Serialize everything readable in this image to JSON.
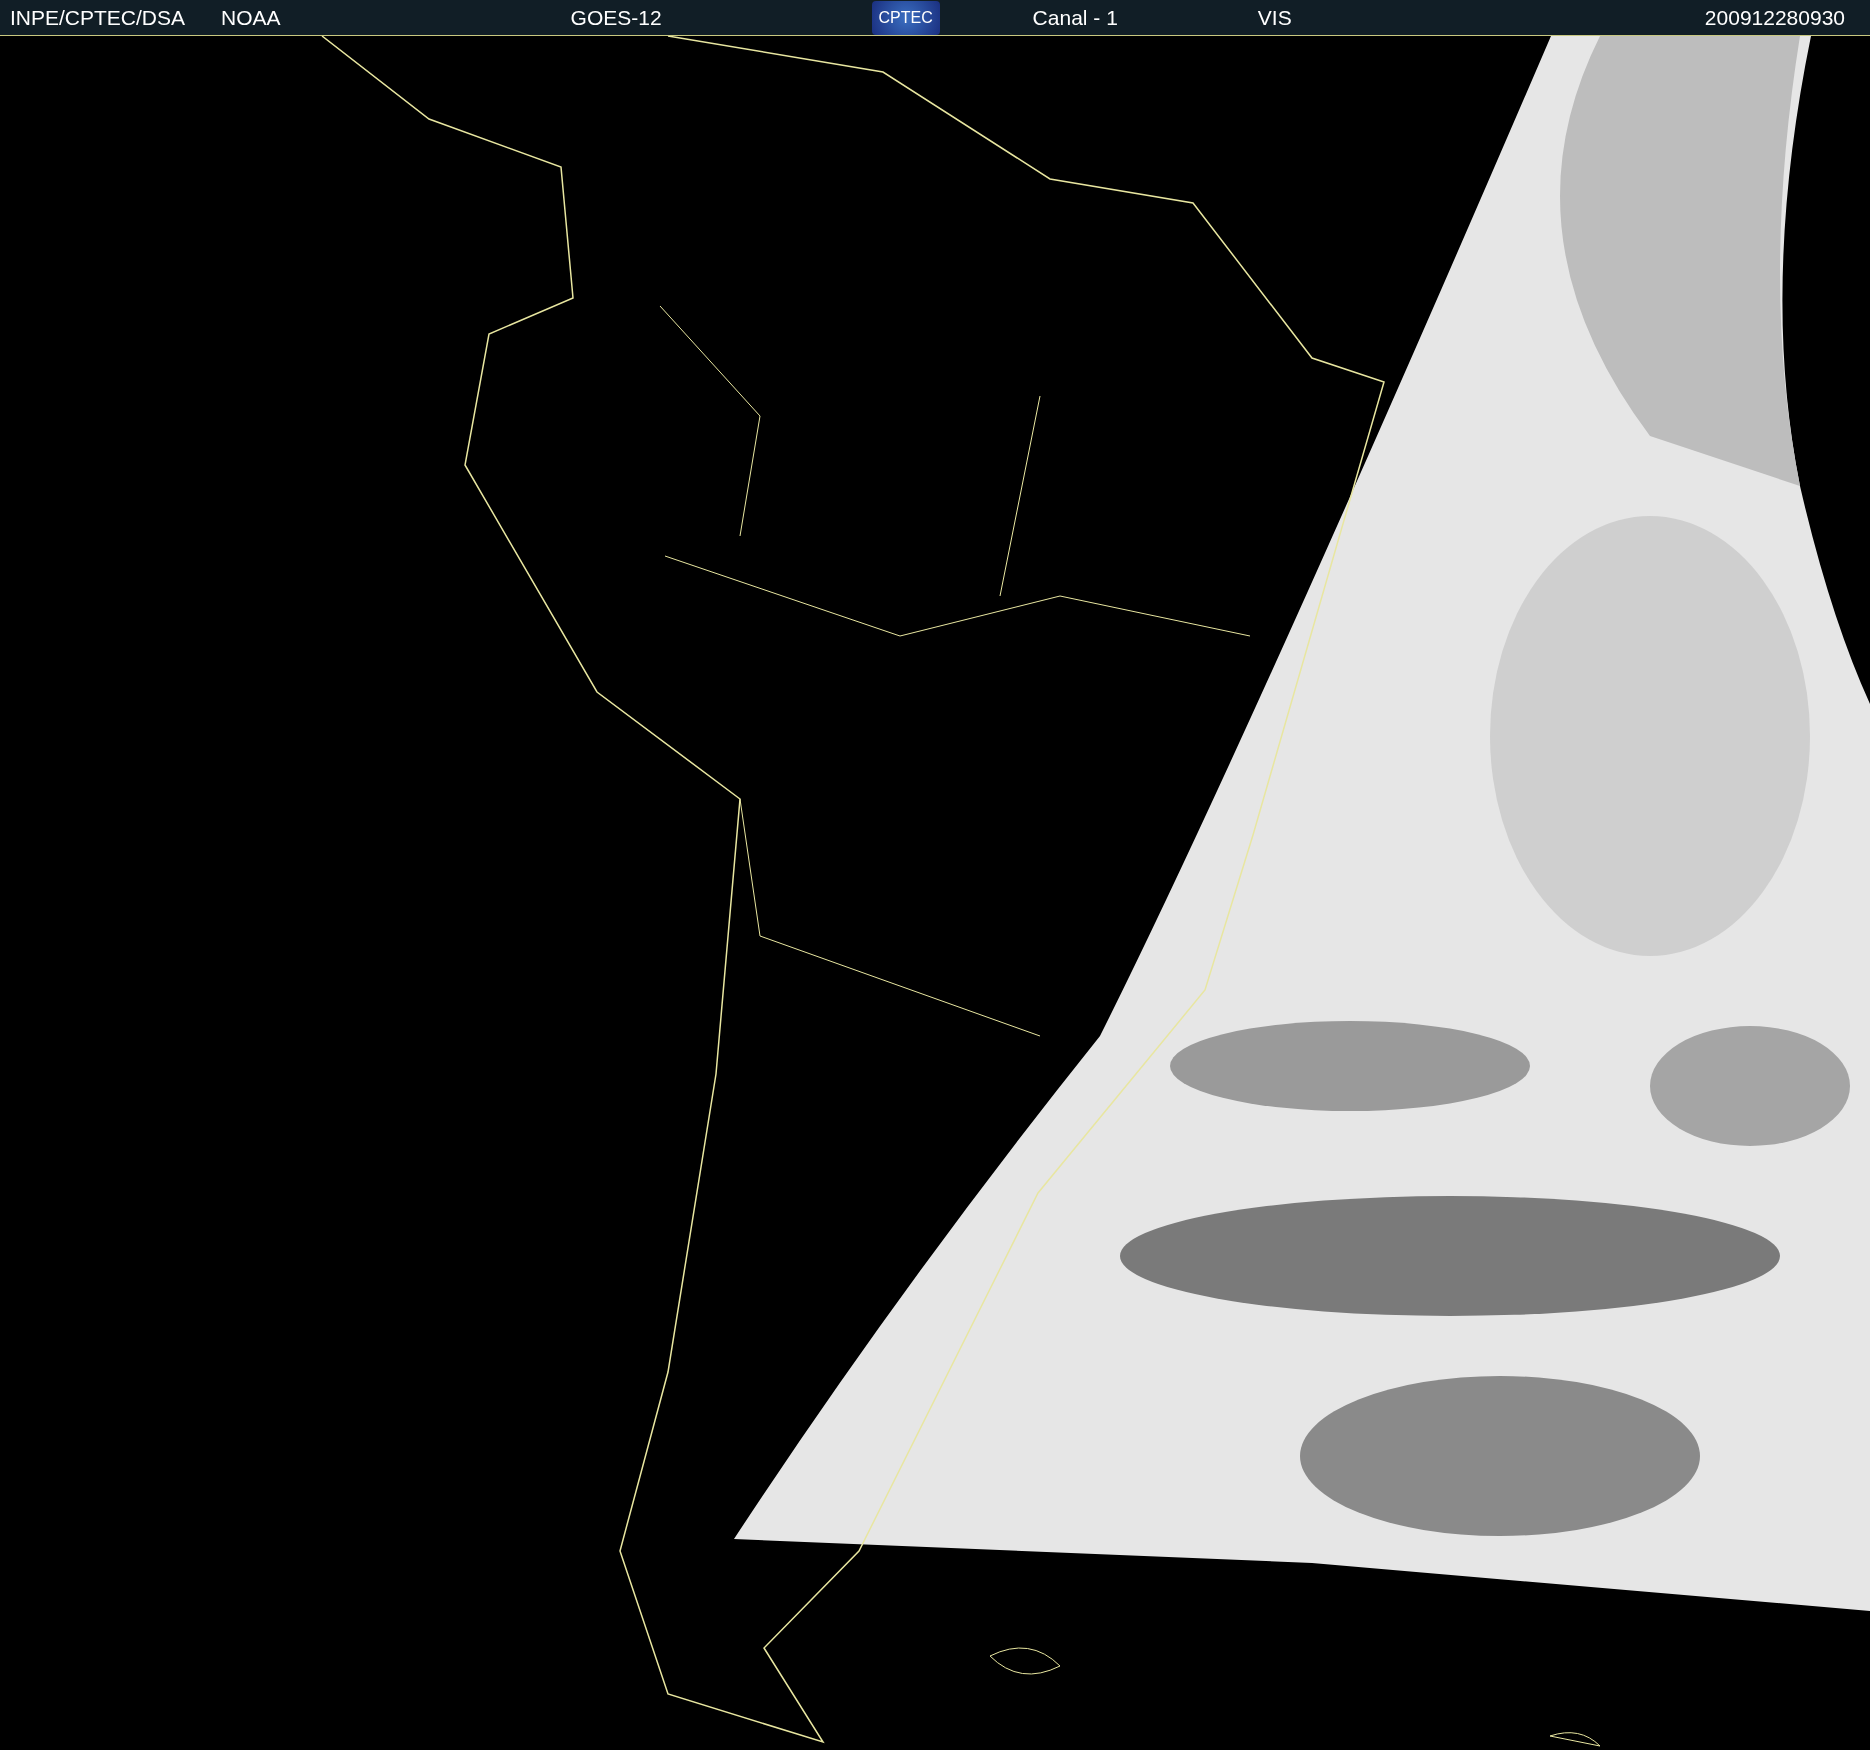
{
  "header": {
    "source": "INPE/CPTEC/DSA",
    "agency": "NOAA",
    "satellite": "GOES-12",
    "logo": "CPTEC",
    "channel": "Canal - 1",
    "band": "VIS",
    "timestamp": "200912280930"
  }
}
